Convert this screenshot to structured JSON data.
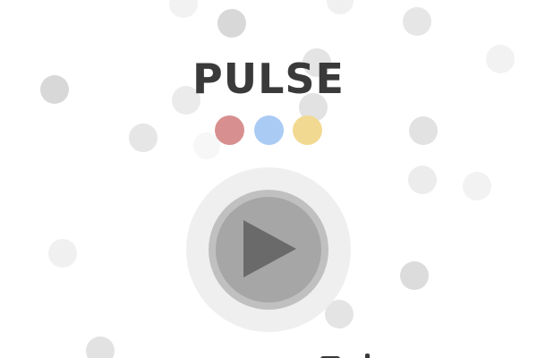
{
  "game": {
    "title": "PULSE"
  },
  "color_options": [
    {
      "name": "red",
      "color": "#d88f8f"
    },
    {
      "name": "blue",
      "color": "#a9cbf4"
    },
    {
      "name": "yellow",
      "color": "#f2d992"
    }
  ],
  "play_button": {
    "icon": "play-icon",
    "outer_color": "#efefef",
    "ring_color": "#c0c0c0",
    "inner_color": "#a6a6a6",
    "icon_color": "#6a6a6a"
  },
  "background": {
    "color": "#ffffff",
    "dot_colors": [
      "#d6d6d6",
      "#e6e6e6",
      "#f2f2f2"
    ]
  },
  "title_color": "#3a3a3a"
}
